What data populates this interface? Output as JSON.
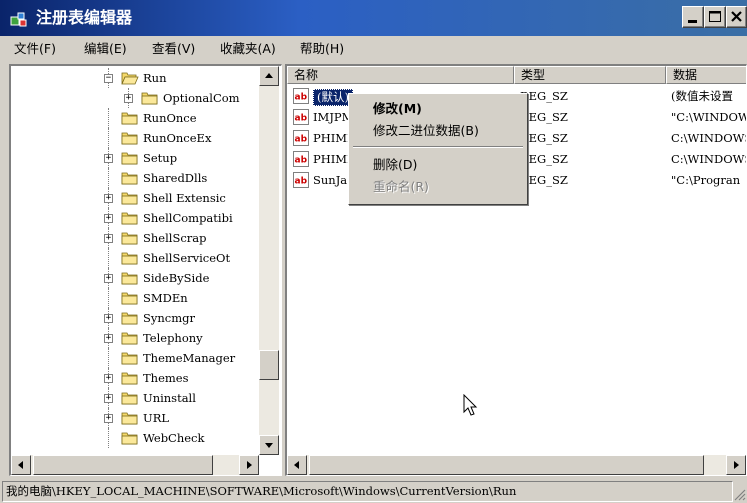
{
  "window": {
    "title": "注册表编辑器"
  },
  "menubar": [
    {
      "label": "文件(F)"
    },
    {
      "label": "编辑(E)"
    },
    {
      "label": "查看(V)"
    },
    {
      "label": "收藏夹(A)"
    },
    {
      "label": "帮助(H)"
    }
  ],
  "tree": {
    "items": [
      {
        "label": "Run",
        "expander": "−",
        "open": true
      },
      {
        "label": "OptionalCom",
        "expander": "+"
      },
      {
        "label": "RunOnce",
        "expander": ""
      },
      {
        "label": "RunOnceEx",
        "expander": ""
      },
      {
        "label": "Setup",
        "expander": "+"
      },
      {
        "label": "SharedDlls",
        "expander": ""
      },
      {
        "label": "Shell Extensic",
        "expander": "+"
      },
      {
        "label": "ShellCompatibi",
        "expander": "+"
      },
      {
        "label": "ShellScrap",
        "expander": "+"
      },
      {
        "label": "ShellServiceOt",
        "expander": ""
      },
      {
        "label": "SideBySide",
        "expander": "+"
      },
      {
        "label": "SMDEn",
        "expander": ""
      },
      {
        "label": "Syncmgr",
        "expander": "+"
      },
      {
        "label": "Telephony",
        "expander": "+"
      },
      {
        "label": "ThemeManager",
        "expander": ""
      },
      {
        "label": "Themes",
        "expander": "+"
      },
      {
        "label": "Uninstall",
        "expander": "+"
      },
      {
        "label": "URL",
        "expander": "+"
      },
      {
        "label": "WebCheck",
        "expander": ""
      }
    ]
  },
  "list": {
    "columns": {
      "name": "名称",
      "type": "类型",
      "data": "数据"
    },
    "rows": [
      {
        "name": "(默认)",
        "type": "REG_SZ",
        "data": "(数值未设置"
      },
      {
        "name": "IMJPM",
        "type": "REG_SZ",
        "data": "\"C:\\WINDOWS"
      },
      {
        "name": "PHIME",
        "type": "REG_SZ",
        "data": "C:\\WINDOWS'"
      },
      {
        "name": "PHIME",
        "type": "REG_SZ",
        "data": "C:\\WINDOWS'"
      },
      {
        "name": "SunJa",
        "type": "REG_SZ",
        "data": "\"C:\\Progran"
      }
    ]
  },
  "context_menu": {
    "modify": "修改(M)",
    "modify_binary": "修改二进位数据(B)",
    "delete": "删除(D)",
    "rename": "重命名(R)"
  },
  "status": {
    "path": "我的电脑\\HKEY_LOCAL_MACHINE\\SOFTWARE\\Microsoft\\Windows\\CurrentVersion\\Run"
  },
  "colors": {
    "title_bar": "#0a246a",
    "selection": "#0a246a",
    "window_bg": "#d4d0c8",
    "folder": "#f5d96b"
  }
}
